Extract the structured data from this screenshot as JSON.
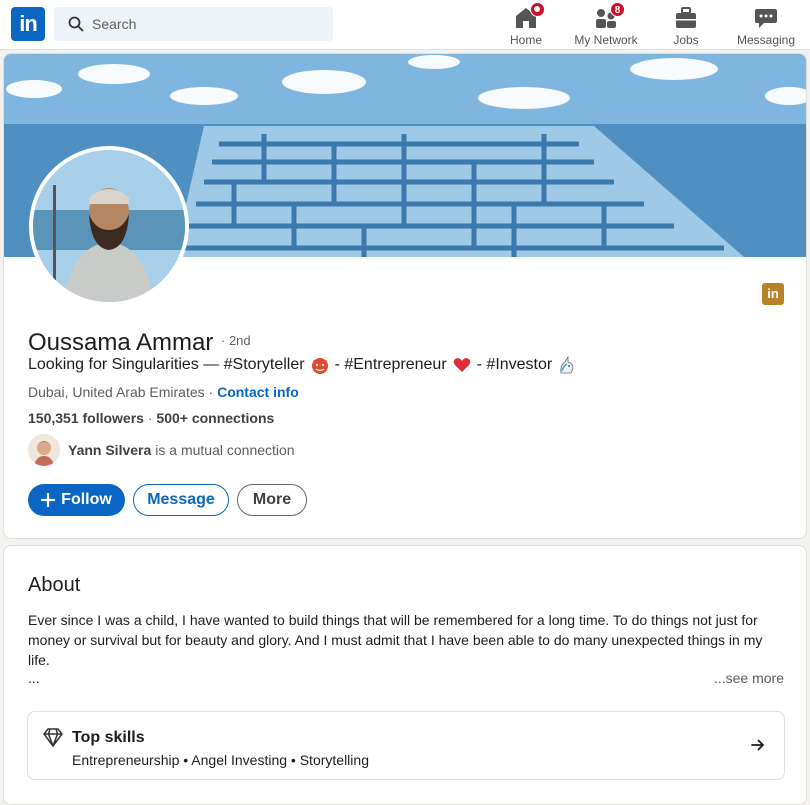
{
  "nav": {
    "search_placeholder": "Search",
    "items": [
      {
        "label": "Home",
        "icon": "home-icon"
      },
      {
        "label": "My Network",
        "icon": "network-icon",
        "badge": "8"
      },
      {
        "label": "Jobs",
        "icon": "briefcase-icon"
      },
      {
        "label": "Messaging",
        "icon": "messaging-icon"
      }
    ],
    "logo_text": "in"
  },
  "profile": {
    "name": "Oussama Ammar",
    "degree": "· 2nd",
    "headline_parts": [
      "Looking for Singularities — #Storyteller",
      "- #Entrepreneur",
      "- #Investor"
    ],
    "location": "Dubai, United Arab Emirates · ",
    "contact_info": "Contact info",
    "followers": "150,351 followers",
    "connections": "500+ connections",
    "mutual_name": "Yann Silvera",
    "mutual_text": "is a mutual connection",
    "buttons": {
      "follow": "Follow",
      "message": "Message",
      "more": "More"
    },
    "brand_mark": "in",
    "accent_color": "#0a66c2"
  },
  "about": {
    "title": "About",
    "text": "Ever since I was a child, I have wanted to build things that will be remembered for a long time. To do things not just for money or survival but for beauty and glory. And I must admit that I have been able to do many unexpected things in my life.",
    "ellipsis": "...",
    "see_more": "...see more",
    "top_skills_title": "Top skills",
    "top_skills": "Entrepreneurship • Angel Investing • Storytelling"
  }
}
